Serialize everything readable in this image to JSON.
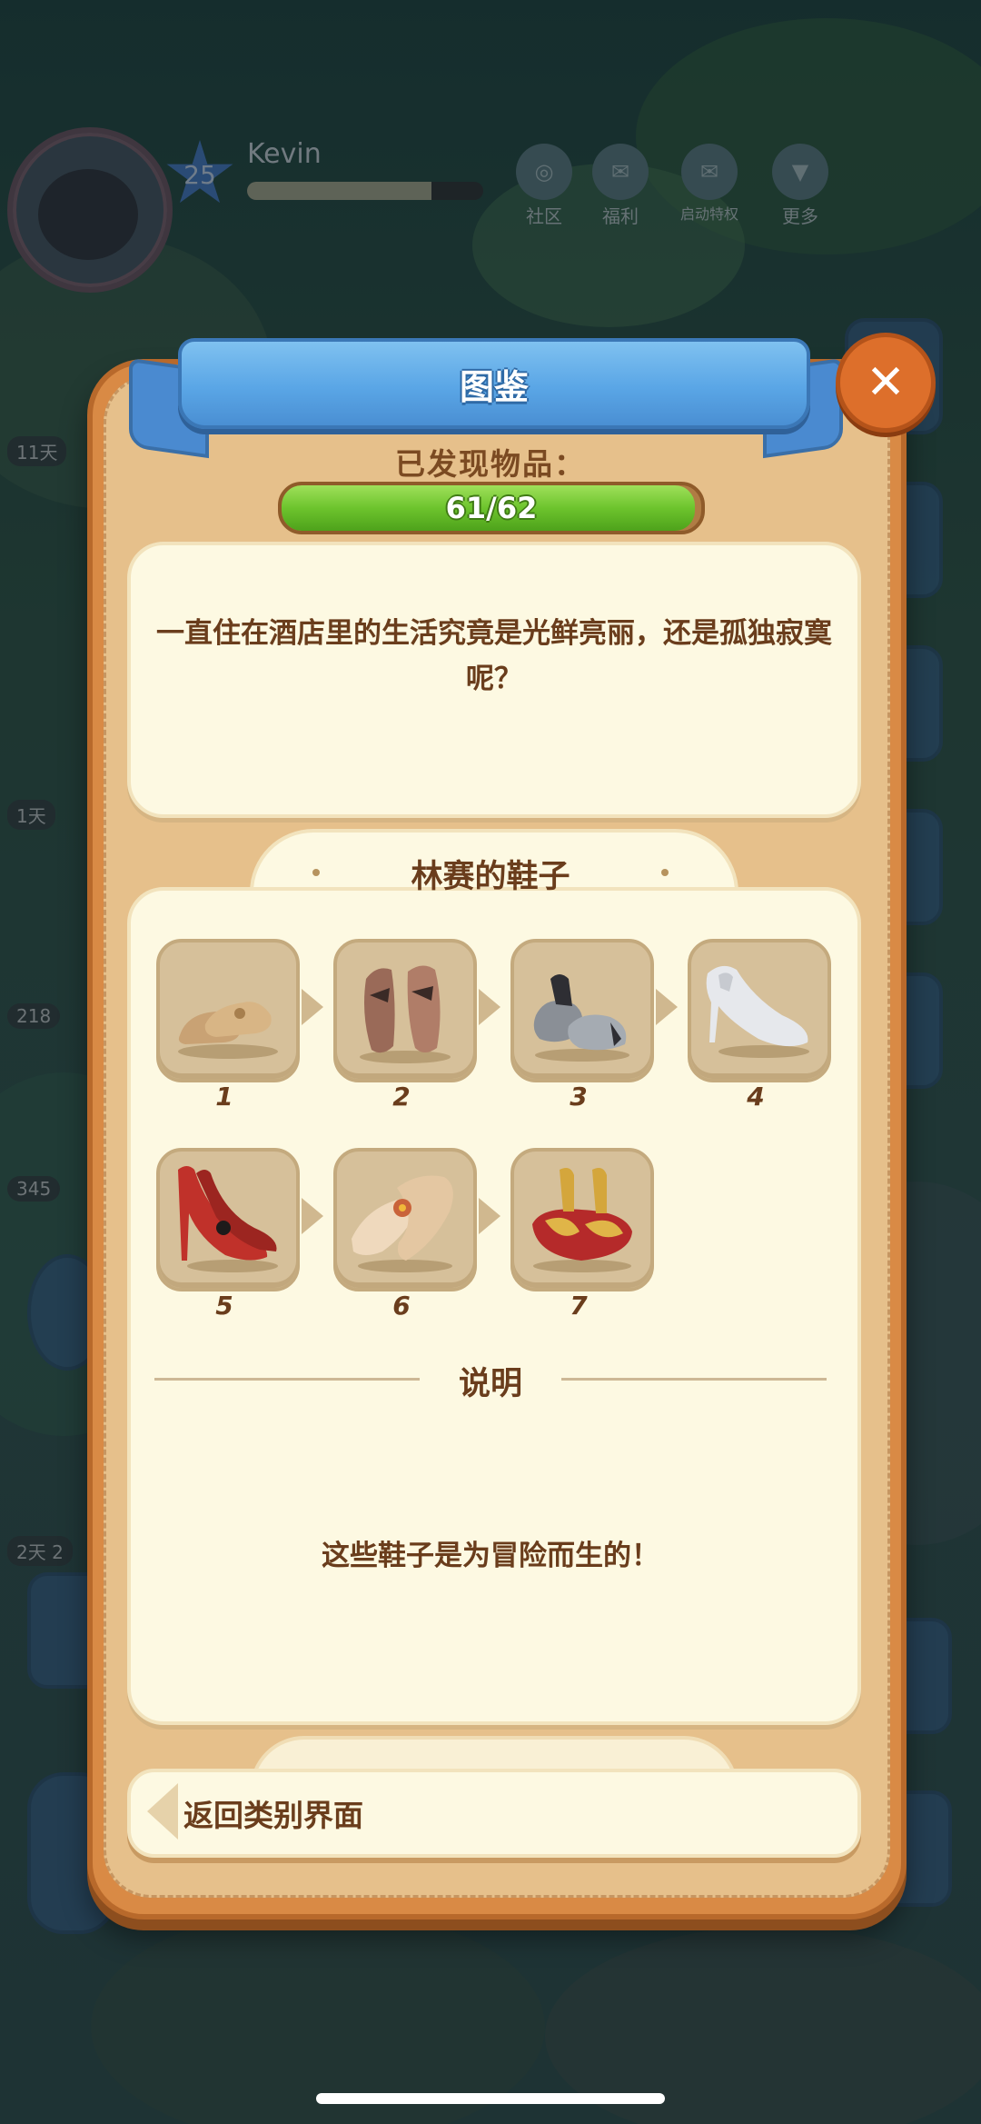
{
  "hud": {
    "level": "25",
    "player_name": "Kevin",
    "xp_fraction": 0.78,
    "buttons": [
      {
        "label": "社区",
        "icon": "community-icon"
      },
      {
        "label": "福利",
        "icon": "wechat-icon"
      },
      {
        "label": "启动特权",
        "icon": "launch-privilege-icon"
      },
      {
        "label": "更多",
        "icon": "more-icon"
      }
    ],
    "timers": [
      "11天",
      "1天",
      "218",
      "345",
      "2天 2"
    ]
  },
  "dialog": {
    "title": "图鉴",
    "found_label": "已发现物品：",
    "progress_text": "61/62",
    "progress_fraction": 0.984,
    "description": "一直住在酒店里的生活究竟是光鲜亮丽，还是孤独寂寞呢？",
    "collection": {
      "title": "林赛的鞋子",
      "items": [
        {
          "number": "1",
          "name": "beige loafers"
        },
        {
          "number": "2",
          "name": "brown bow shoes"
        },
        {
          "number": "3",
          "name": "black-and-silver mary janes"
        },
        {
          "number": "4",
          "name": "silver mules"
        },
        {
          "number": "5",
          "name": "red high heels"
        },
        {
          "number": "6",
          "name": "cream heels with flower"
        },
        {
          "number": "7",
          "name": "red and gold heels on bag"
        }
      ]
    },
    "note_title": "说明",
    "note_text": "这些鞋子是为冒险而生的！",
    "back_label": "返回类别界面"
  },
  "colors": {
    "ribbon": "#5aa6e6",
    "frame": "#d98a45",
    "panel": "#fdf9e2",
    "text": "#6a3d1c",
    "progress": "#6dc42d",
    "close": "#dd6f2b"
  }
}
